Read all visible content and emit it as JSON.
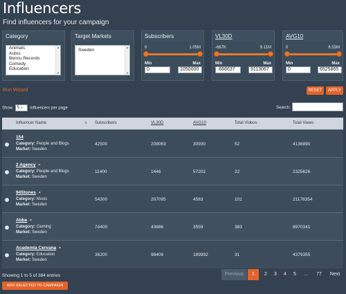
{
  "page": {
    "title": "Influencers",
    "subtitle": "Find influencers for your campaign"
  },
  "filters": {
    "category": {
      "label": "Category",
      "options": [
        "Animals",
        "Autos",
        "Bencu Records",
        "Comedy",
        "Education"
      ]
    },
    "markets": {
      "label": "Target Markets",
      "options": [
        "Sweden"
      ]
    },
    "subscribers": {
      "label": "Subscribers",
      "range_min_label": "0",
      "range_max_label": "1.05M",
      "min_label": "Min",
      "max_label": "Max",
      "min_value": "0",
      "max_value": "1050000",
      "low_fraction": 0.0,
      "high_fraction": 1.0
    },
    "vl30d": {
      "label": "VL30D",
      "range_min_label": "-667K",
      "range_max_label": "9.11M",
      "min_label": "Min",
      "max_label": "Max",
      "min_value": "-666637",
      "max_value": "9113067",
      "low_fraction": 0.0,
      "high_fraction": 1.0
    },
    "avg10": {
      "label": "AVG10",
      "range_min_label": "0",
      "range_max_label": "6.53M",
      "min_label": "Min",
      "max_label": "Max",
      "min_value": "0",
      "max_value": "6525865",
      "low_fraction": 0.0,
      "high_fraction": 1.0
    }
  },
  "actions": {
    "run_wizard": "Run Wizard",
    "reset": "RESET",
    "apply": "APPLY"
  },
  "table_controls": {
    "show_label": "Show",
    "per_page_value": "5",
    "per_page_suffix": "influencers per page",
    "search_label": "Search:",
    "search_value": ""
  },
  "table": {
    "columns": [
      "Influencer Name",
      "Subscribers",
      "VL30D",
      "AVG10",
      "Total Videos",
      "Total Views"
    ],
    "category_label": "Category:",
    "market_label": "Market:",
    "rows": [
      {
        "name": "154",
        "category": "People and Blogs",
        "market": "Sweden",
        "subscribers": "42500",
        "vl30d": "208063",
        "avg10": "30930",
        "videos": "52",
        "views": "4136890"
      },
      {
        "name": "2 Agency",
        "category": "People and Blogs",
        "market": "Sweden",
        "subscribers": "11400",
        "vl30d": "1446",
        "avg10": "57202",
        "videos": "22",
        "views": "2325626"
      },
      {
        "name": "94Stones",
        "category": "Music",
        "market": "Sweden",
        "subscribers": "54300",
        "vl30d": "207095",
        "avg10": "4583",
        "videos": "101",
        "views": "21178354"
      },
      {
        "name": "Abbe",
        "category": "Gaming",
        "market": "Sweden",
        "subscribers": "74400",
        "vl30d": "43686",
        "avg10": "3559",
        "videos": "383",
        "views": "8970341"
      },
      {
        "name": "Academia Cervana",
        "category": "Education",
        "market": "Sweden",
        "subscribers": "36200",
        "vl30d": "98409",
        "avg10": "189992",
        "videos": "31",
        "views": "4379355"
      }
    ]
  },
  "footer": {
    "showing": "Showing 1 to 5 of 384 entries",
    "pagination": [
      "Previous",
      "1",
      "2",
      "3",
      "4",
      "5",
      "...",
      "77",
      "Next"
    ],
    "active_page": "1",
    "add_selected": "ADD SELECTED TO CAMPAIGN"
  },
  "colors": {
    "background": "#334150",
    "accent": "#e2642a",
    "header_row": "#cfd6dd"
  }
}
